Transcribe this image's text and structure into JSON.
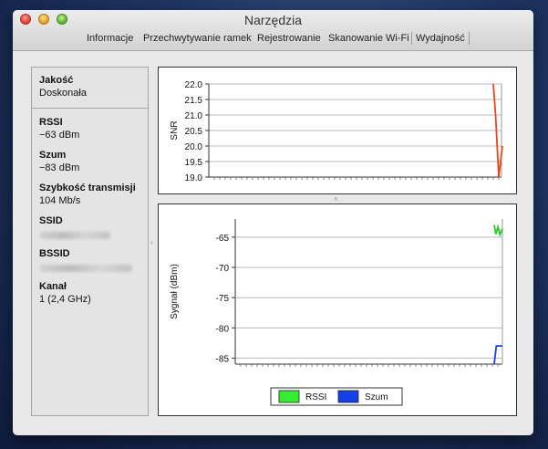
{
  "window": {
    "title": "Narzędzia",
    "tabs": [
      {
        "label": "Informacje"
      },
      {
        "label": "Przechwytywanie ramek"
      },
      {
        "label": "Rejestrowanie"
      },
      {
        "label": "Skanowanie Wi-Fi"
      },
      {
        "label": "Wydajność",
        "active": true
      }
    ]
  },
  "info": {
    "quality_label": "Jakość",
    "quality_value": "Doskonała",
    "rssi_label": "RSSI",
    "rssi_value": "−63 dBm",
    "noise_label": "Szum",
    "noise_value": "−83 dBm",
    "rate_label": "Szybkość transmisji",
    "rate_value": "104 Mb/s",
    "ssid_label": "SSID",
    "bssid_label": "BSSID",
    "channel_label": "Kanał",
    "channel_value": "1 (2,4 GHz)"
  },
  "colors": {
    "snr_line": "#e8461f",
    "rssi_line": "#22cc22",
    "noise_line": "#1644e0",
    "legend_rssi": "#33ee33",
    "legend_noise": "#1340e8"
  },
  "chart_data": [
    {
      "type": "line",
      "ylabel": "SNR",
      "ylim": [
        19.0,
        22.0
      ],
      "yticks": [
        "22.0",
        "21.5",
        "21.0",
        "20.5",
        "20.0",
        "19.5",
        "19.0"
      ],
      "grid": true,
      "series": [
        {
          "points": [
            [
              0,
              22.0
            ],
            [
              0.25,
              21.0
            ],
            [
              0.6,
              19.0
            ],
            [
              1.0,
              20.0
            ]
          ]
        }
      ]
    },
    {
      "type": "line",
      "ylabel": "Sygnał (dBm)",
      "ylim": [
        -86,
        -62
      ],
      "yticks": [
        "-65",
        "-70",
        "-75",
        "-80",
        "-85"
      ],
      "grid": true,
      "legend": "bottom",
      "series": [
        {
          "name": "RSSI",
          "points": [
            [
              0,
              -63.0
            ],
            [
              0.2,
              -64.5
            ],
            [
              0.45,
              -63.3
            ],
            [
              0.7,
              -64.6
            ],
            [
              1.0,
              -63.6
            ]
          ]
        },
        {
          "name": "Szum",
          "points": [
            [
              0,
              -86.0
            ],
            [
              0.25,
              -83.0
            ],
            [
              1.0,
              -83.0
            ]
          ]
        }
      ]
    }
  ]
}
